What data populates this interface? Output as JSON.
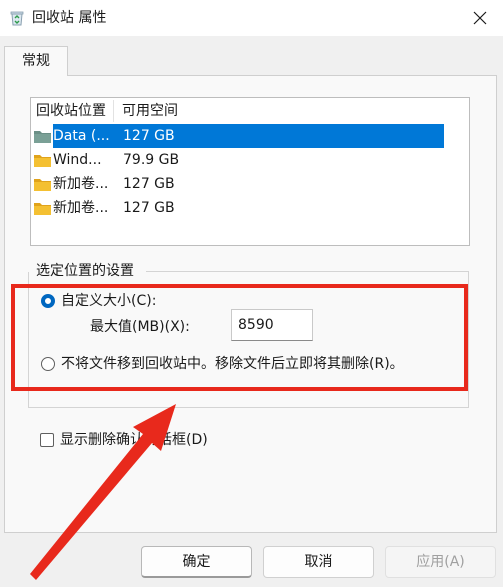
{
  "window": {
    "title": "回收站 属性",
    "icon": "recycle-bin-icon",
    "close_icon": "close-icon"
  },
  "tabs": [
    {
      "label": "常规",
      "active": true
    }
  ],
  "locations": {
    "headers": [
      "回收站位置",
      "可用空间"
    ],
    "rows": [
      {
        "name": "Data (...",
        "space": "127 GB",
        "icon": "drive-folder-icon",
        "selected": true
      },
      {
        "name": "Wind...",
        "space": "79.9 GB",
        "icon": "folder-icon",
        "selected": false
      },
      {
        "name": "新加卷...",
        "space": "127 GB",
        "icon": "folder-icon",
        "selected": false
      },
      {
        "name": "新加卷...",
        "space": "127 GB",
        "icon": "folder-icon",
        "selected": false
      }
    ]
  },
  "settings": {
    "group_label": "选定位置的设置",
    "custom_size_label": "自定义大小(C):",
    "custom_size_checked": true,
    "max_size_label": "最大值(MB)(X):",
    "max_size_value": "8590",
    "no_recycle_label": "不将文件移到回收站中。移除文件后立即将其删除(R)。",
    "no_recycle_checked": false
  },
  "confirm_delete": {
    "label": "显示删除确认对话框(D)",
    "checked": false
  },
  "buttons": {
    "ok": "确定",
    "cancel": "取消",
    "apply": "应用(A)",
    "apply_enabled": false
  },
  "colors": {
    "selection": "#0078d7",
    "annotation_red": "#e8291c",
    "radio_accent": "#0067c0"
  }
}
